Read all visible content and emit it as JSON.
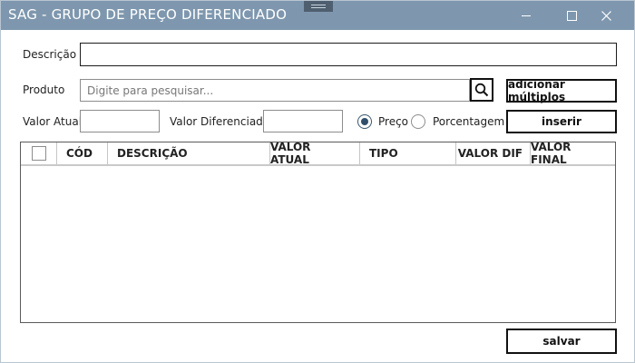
{
  "window": {
    "title": "SAG - GRUPO DE PREÇO DIFERENCIADO"
  },
  "form": {
    "descricao_label": "Descrição",
    "descricao_value": "",
    "produto_label": "Produto",
    "produto_placeholder": "Digite para pesquisar...",
    "valor_atual_label": "Valor Atual",
    "valor_atual_value": "",
    "valor_diferenciado_label": "Valor Diferenciado",
    "valor_diferenciado_value": "",
    "radio_preco_label": "Preço",
    "radio_porcentagem_label": "Porcentagem",
    "selected_mode": "Preço"
  },
  "buttons": {
    "adicionar_multiplos": "adicionar múltiplos",
    "inserir": "inserir",
    "salvar": "salvar"
  },
  "table": {
    "columns": [
      "CÓD",
      "DESCRIÇÃO",
      "VALOR ATUAL",
      "TIPO",
      "VALOR DIF",
      "VALOR FINAL"
    ],
    "rows": []
  },
  "icons": [
    "search-icon",
    "minimize-icon",
    "maximize-icon",
    "close-icon",
    "drag-handle-icon"
  ],
  "colors": {
    "titlebar": "#7e97ae",
    "radio_selected": "#2f4f6c"
  }
}
